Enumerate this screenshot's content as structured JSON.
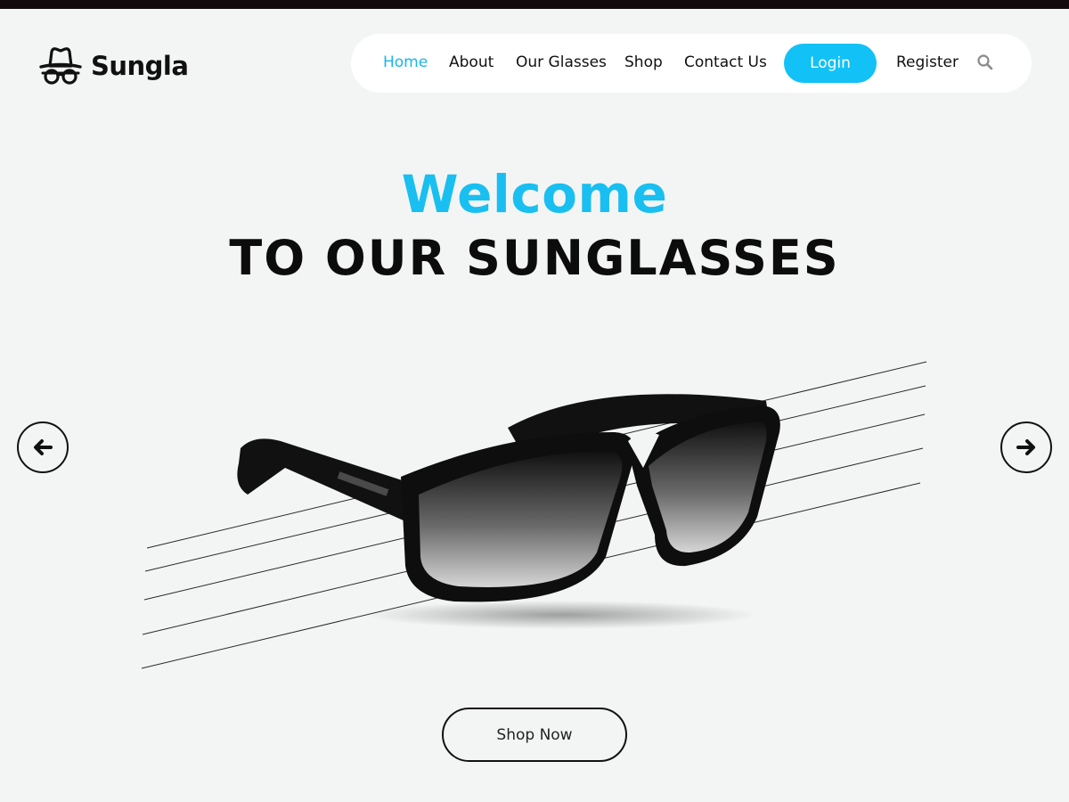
{
  "brand": {
    "name": "Sungla",
    "logo_icon": "hat-glasses-icon"
  },
  "nav": {
    "items": [
      {
        "label": "Home",
        "active": true
      },
      {
        "label": "About",
        "active": false
      },
      {
        "label": "Our Glasses",
        "active": false
      },
      {
        "label": "Shop",
        "active": false
      },
      {
        "label": "Contact Us",
        "active": false
      }
    ],
    "login_label": "Login",
    "register_label": "Register",
    "search_icon": "search-icon"
  },
  "hero": {
    "welcome": "Welcome",
    "subtitle": "TO OUR SUNGLASSES",
    "prev_icon": "arrow-left-icon",
    "next_icon": "arrow-right-icon",
    "cta_label": "Shop Now"
  },
  "colors": {
    "accent": "#12c1f5",
    "background": "#f3f5f4",
    "text": "#111111"
  }
}
